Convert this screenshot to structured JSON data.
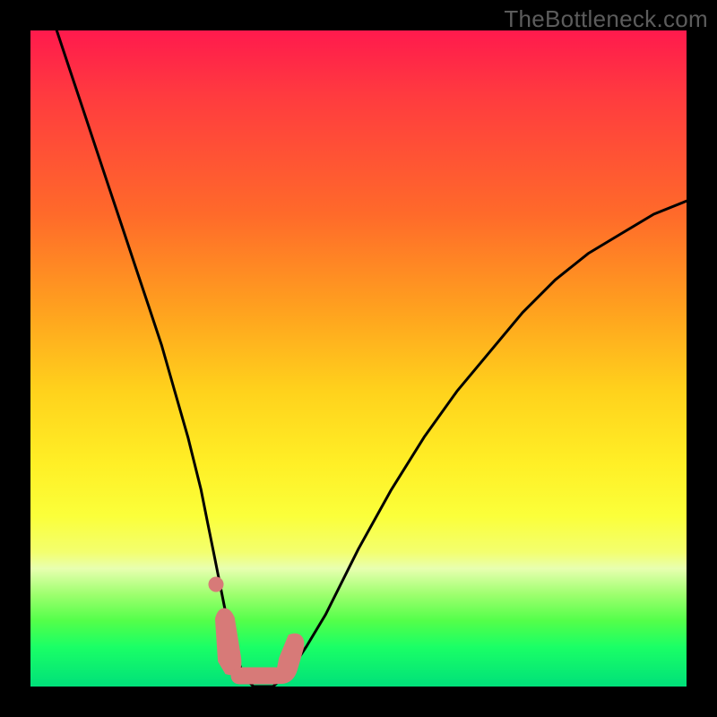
{
  "watermark": {
    "text": "TheBottleneck.com"
  },
  "chart_data": {
    "type": "line",
    "title": "",
    "xlabel": "",
    "ylabel": "",
    "xlim": [
      0,
      100
    ],
    "ylim": [
      0,
      100
    ],
    "grid": false,
    "legend": false,
    "series": [
      {
        "name": "curve",
        "x": [
          4,
          6,
          8,
          10,
          12,
          14,
          16,
          18,
          20,
          22,
          24,
          26,
          27,
          28,
          29,
          30,
          31,
          32,
          33,
          34,
          35,
          36,
          37,
          38,
          40,
          42,
          45,
          50,
          55,
          60,
          65,
          70,
          75,
          80,
          85,
          90,
          95,
          100
        ],
        "values": [
          100,
          94,
          88,
          82,
          76,
          70,
          64,
          58,
          52,
          45,
          38,
          30,
          25,
          20,
          15,
          10,
          6,
          3,
          1,
          0,
          0,
          0,
          0,
          1,
          3,
          6,
          11,
          21,
          30,
          38,
          45,
          51,
          57,
          62,
          66,
          69,
          72,
          74
        ]
      }
    ],
    "markers": [
      {
        "name": "pink-dot",
        "x": 28.3,
        "y": 15.5
      },
      {
        "name": "pink-left-lobe",
        "x_range": [
          29.0,
          30.1
        ],
        "y_range": [
          3.0,
          10.0
        ]
      },
      {
        "name": "pink-bottom-bar",
        "x_range": [
          30.5,
          38.0
        ],
        "y_range": [
          0.0,
          1.6
        ]
      },
      {
        "name": "pink-right-lobe",
        "x_range": [
          38.0,
          40.5
        ],
        "y_range": [
          1.0,
          5.5
        ]
      }
    ],
    "background_gradient": {
      "stops": [
        {
          "pos": 0.0,
          "color": "#ff1a4d"
        },
        {
          "pos": 0.28,
          "color": "#ff6a2a"
        },
        {
          "pos": 0.55,
          "color": "#ffd21c"
        },
        {
          "pos": 0.8,
          "color": "#f3ff6e"
        },
        {
          "pos": 0.9,
          "color": "#53ff4a"
        },
        {
          "pos": 1.0,
          "color": "#00e07a"
        }
      ]
    }
  }
}
